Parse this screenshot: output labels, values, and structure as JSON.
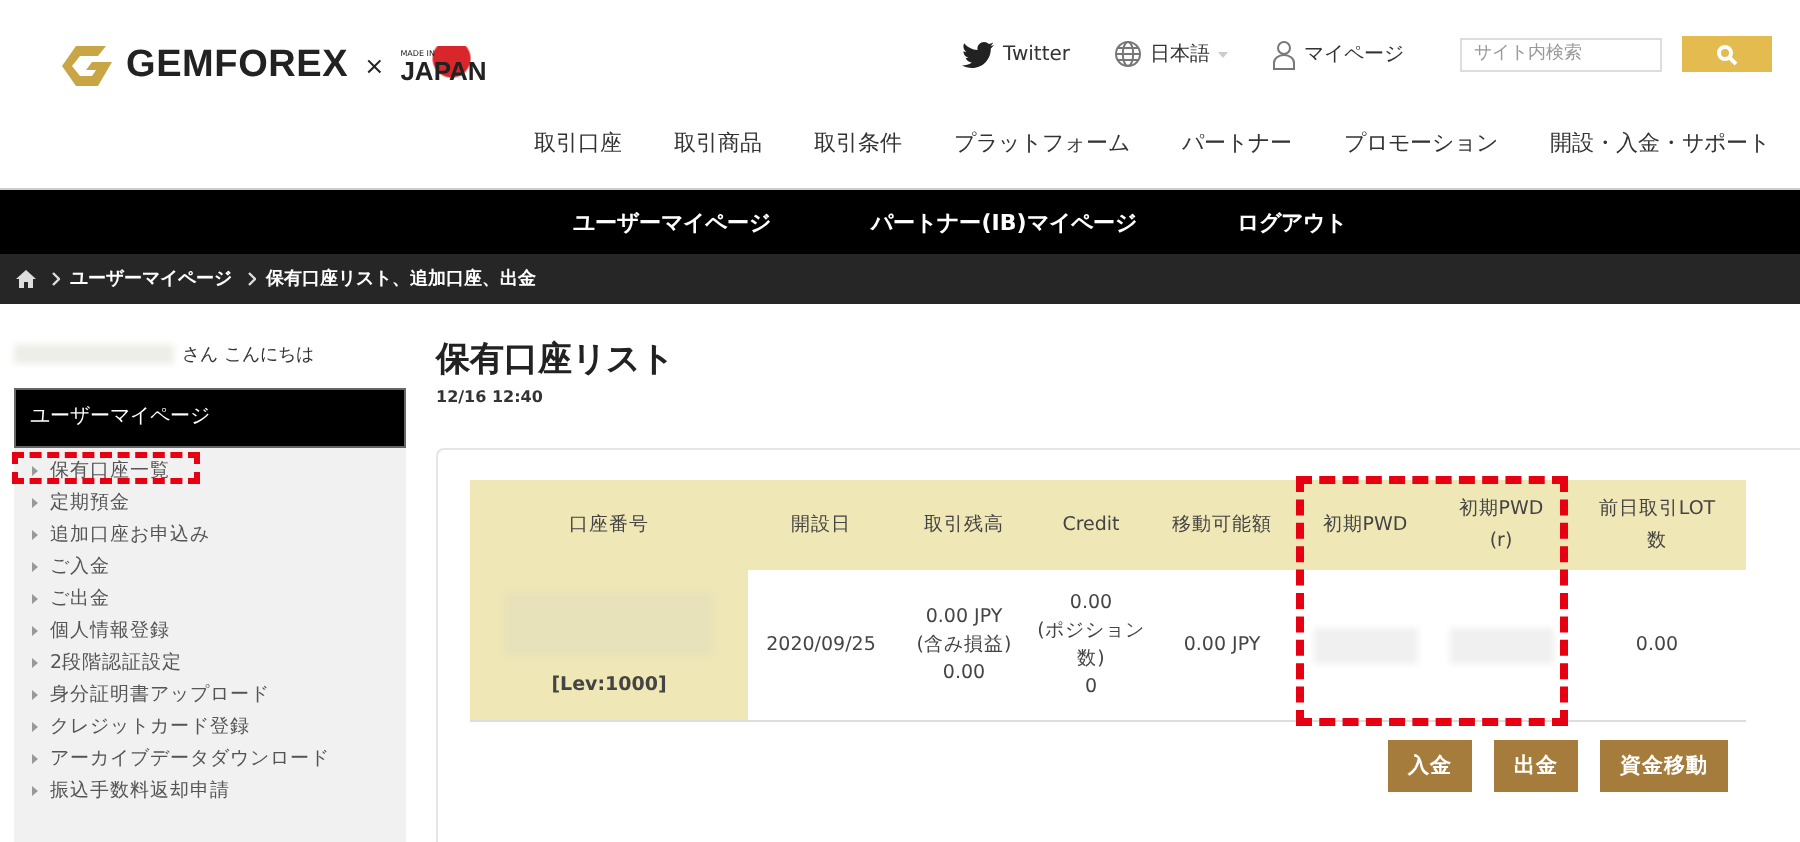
{
  "header": {
    "brand": "GEMFOREX",
    "cross": "×",
    "badge_small": "MADE IN",
    "badge_big": "JAPAN",
    "utility": [
      {
        "kind": "twitter",
        "label": "Twitter"
      },
      {
        "kind": "language",
        "label": "日本語"
      },
      {
        "kind": "user",
        "label": "マイページ"
      }
    ],
    "search": {
      "placeholder": "サイト内検索"
    },
    "menu": [
      "取引口座",
      "取引商品",
      "取引条件",
      "プラットフォーム",
      "パートナー",
      "プロモーション",
      "開設・入金・サポート"
    ]
  },
  "user_bar": [
    "ユーザーマイページ",
    "パートナー(IB)マイページ",
    "ログアウト"
  ],
  "breadcrumb": [
    "ユーザーマイページ",
    "保有口座リスト、追加口座、出金"
  ],
  "sidebar": {
    "greeting": "さん こんにちは",
    "title": "ユーザーマイページ",
    "items": [
      {
        "label": "保有口座一覧",
        "highlighted": true
      },
      {
        "label": "定期預金",
        "highlighted": false
      },
      {
        "label": "追加口座お申込み",
        "highlighted": false
      },
      {
        "label": "ご入金",
        "highlighted": false
      },
      {
        "label": "ご出金",
        "highlighted": false
      },
      {
        "label": "個人情報登録",
        "highlighted": false
      },
      {
        "label": "2段階認証設定",
        "highlighted": false
      },
      {
        "label": "身分証明書アップロード",
        "highlighted": false
      },
      {
        "label": "クレジットカード登録",
        "highlighted": false
      },
      {
        "label": "アーカイブデータダウンロード",
        "highlighted": false
      },
      {
        "label": "振込手数料返却申請",
        "highlighted": false
      }
    ]
  },
  "page": {
    "title": "保有口座リスト",
    "timestamp": "12/16 12:40"
  },
  "table": {
    "columns": [
      {
        "label": "口座番号",
        "highlighted": false
      },
      {
        "label": "開設日",
        "highlighted": false
      },
      {
        "label": "取引残高",
        "highlighted": false
      },
      {
        "label": "Credit",
        "highlighted": false
      },
      {
        "label": "移動可能額",
        "highlighted": false
      },
      {
        "label": "初期PWD",
        "highlighted": true
      },
      {
        "label": "初期PWD\n(r)",
        "highlighted": true
      },
      {
        "label": "前日取引LOT\n数",
        "highlighted": false
      }
    ],
    "rows": [
      {
        "cells": [
          {
            "kind": "account",
            "text": "[Lev:1000]"
          },
          {
            "kind": "text",
            "text": "2020/09/25"
          },
          {
            "kind": "text",
            "text": "0.00 JPY\n(含み損益)\n0.00"
          },
          {
            "kind": "text",
            "text": "0.00\n(ポジション数)\n0"
          },
          {
            "kind": "text",
            "text": "0.00 JPY"
          },
          {
            "kind": "redacted"
          },
          {
            "kind": "redacted"
          },
          {
            "kind": "text",
            "text": "0.00"
          }
        ]
      }
    ]
  },
  "buttons": [
    "入金",
    "出金",
    "資金移動"
  ]
}
